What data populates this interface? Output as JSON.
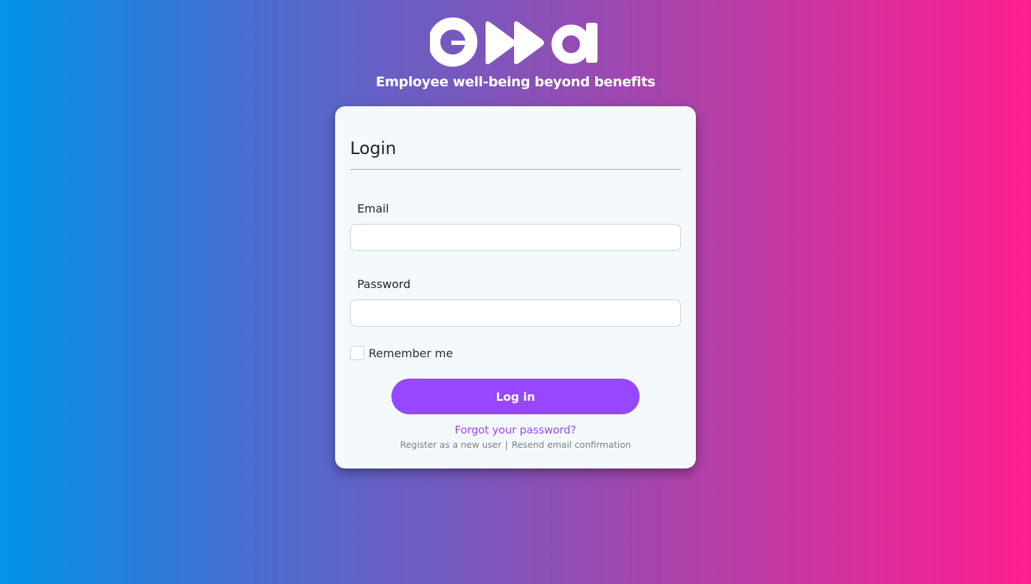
{
  "brand": {
    "logo_text": "ema",
    "tagline": "Employee well-being beyond benefits"
  },
  "login": {
    "title": "Login",
    "email_label": "Email",
    "email_value": "",
    "password_label": "Password",
    "password_value": "",
    "remember_label": "Remember me",
    "remember_checked": false,
    "submit_label": "Log in",
    "forgot_link": "Forgot your password?",
    "register_link": "Register as a new user",
    "separator": "|",
    "resend_link": "Resend email confirmation"
  },
  "colors": {
    "accent": "#9747ff",
    "gradient_start": "#0194e8",
    "gradient_end": "#ff1d8e",
    "card_background": "#f4f9fc"
  }
}
